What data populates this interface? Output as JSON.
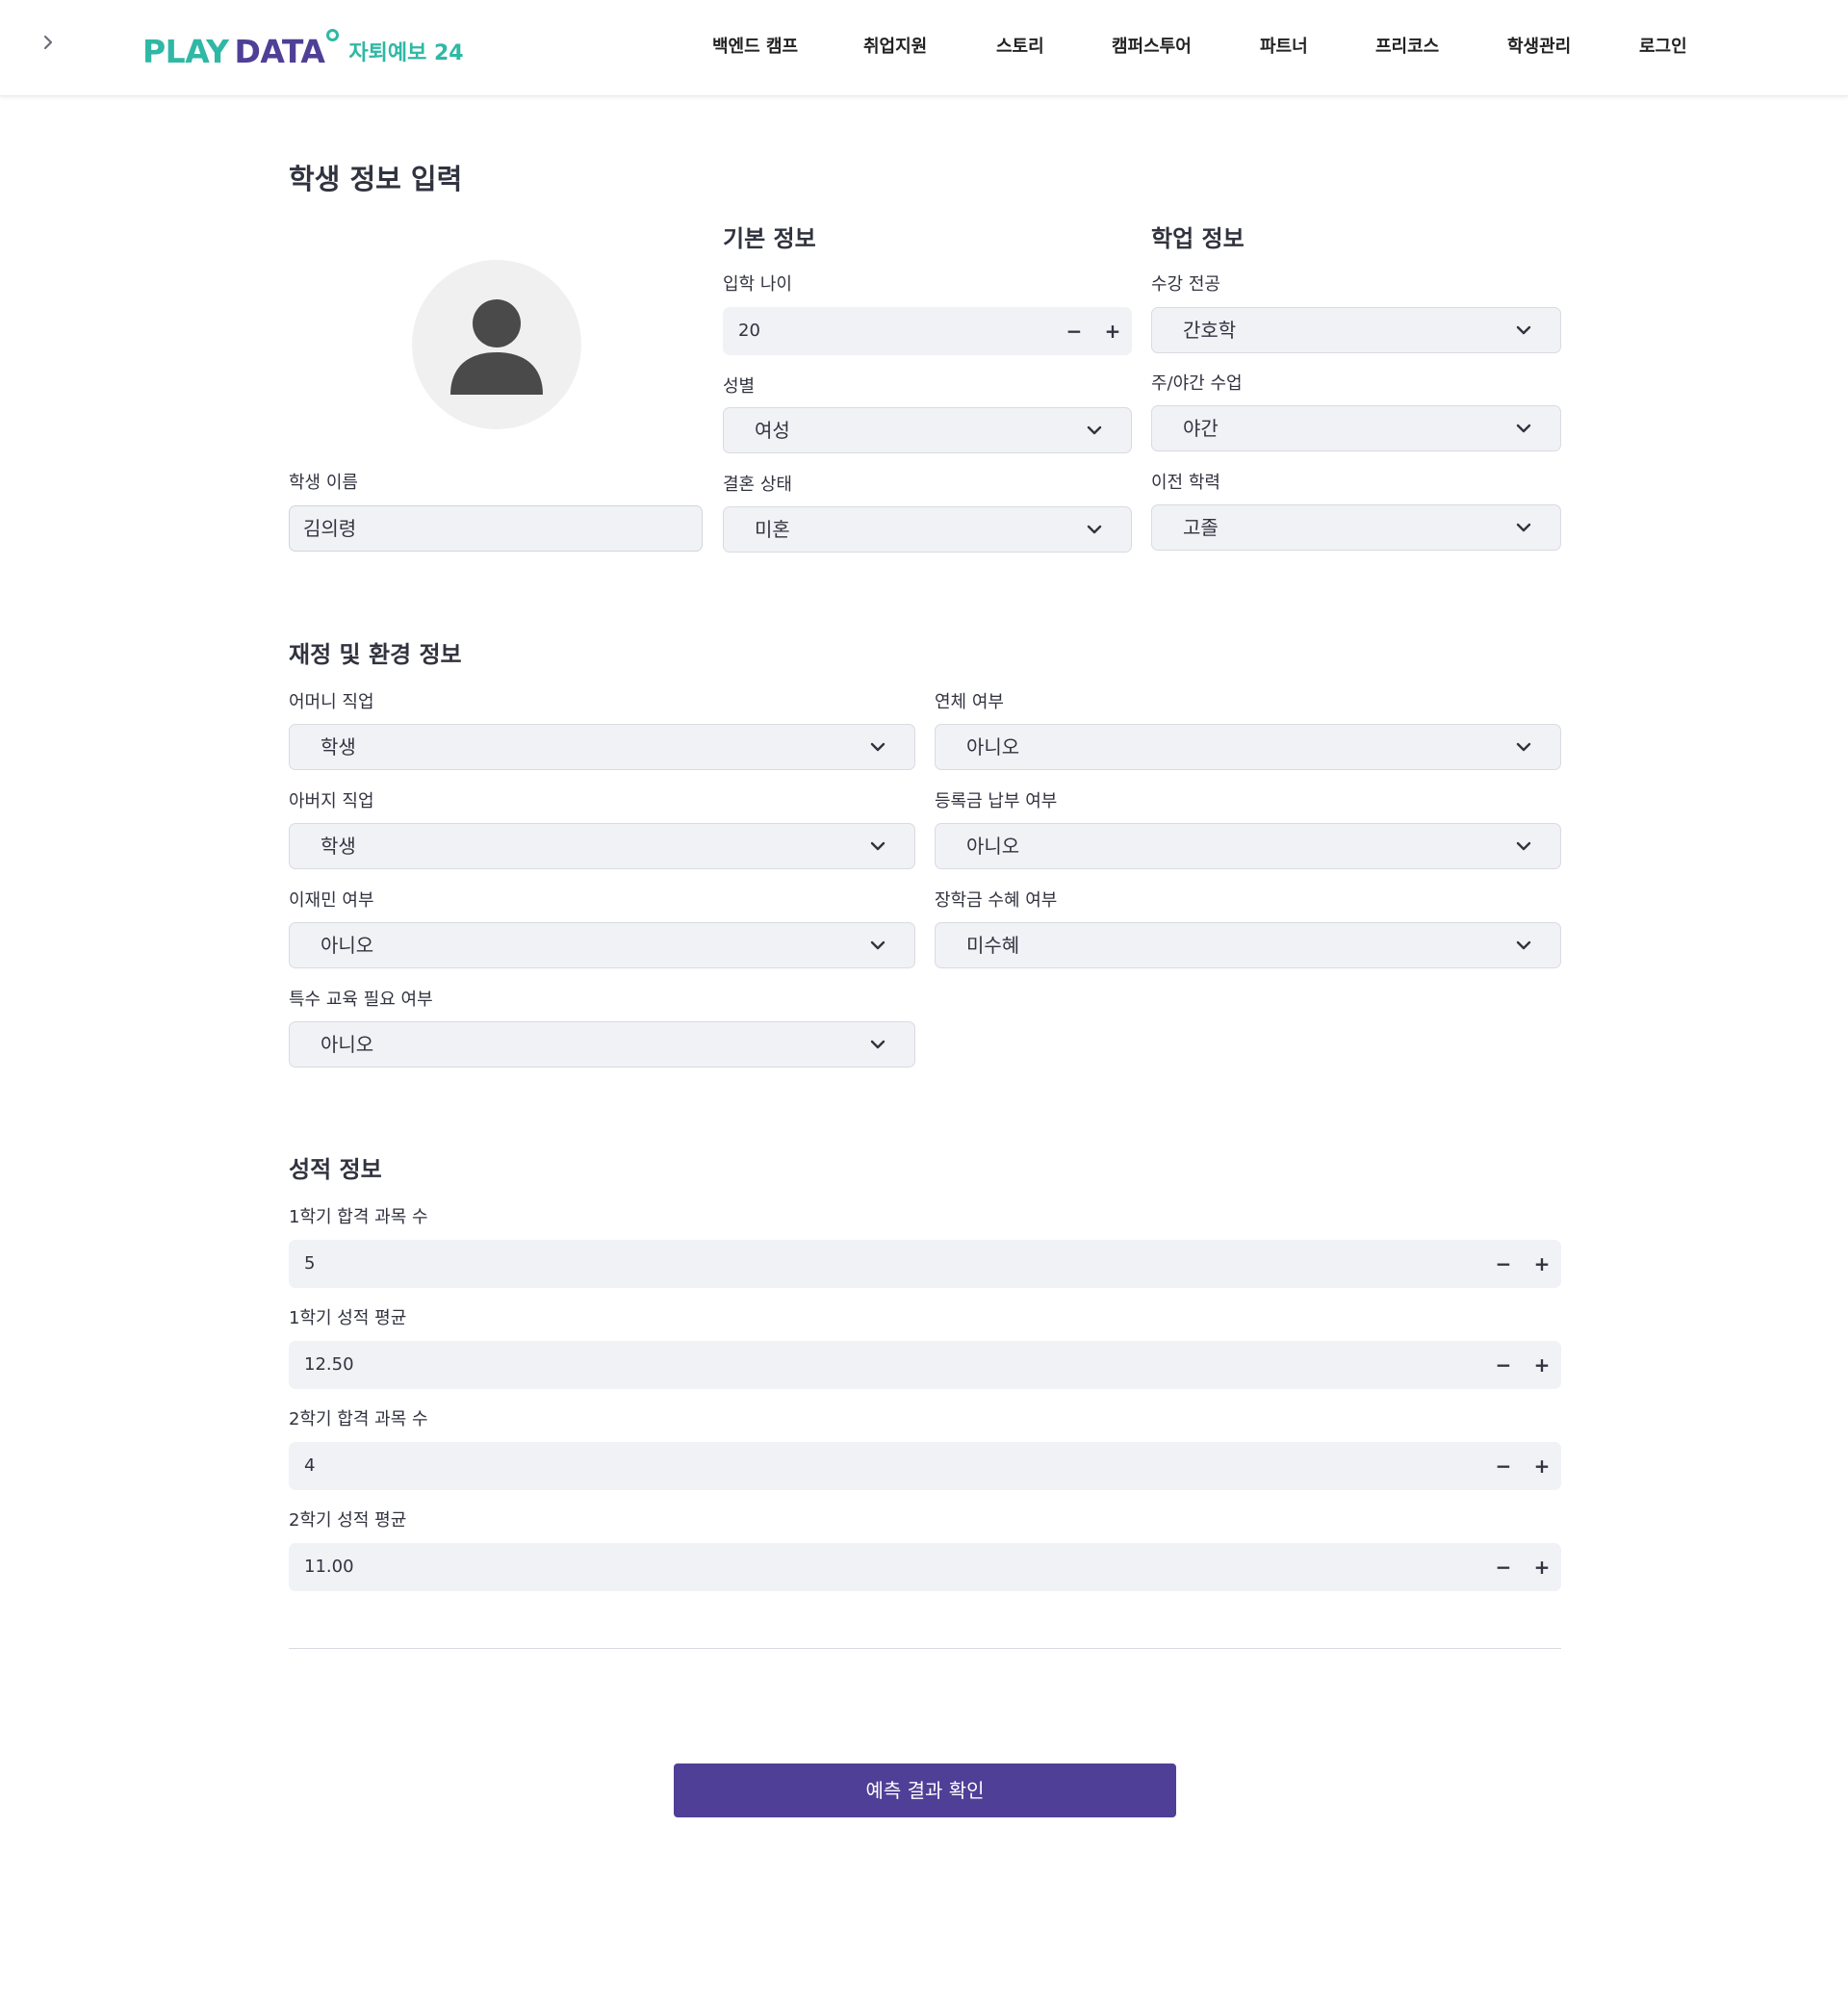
{
  "header": {
    "logo": {
      "play": "PLAY",
      "data": "DATA",
      "sub": "자퇴예보 24"
    },
    "nav": [
      "백엔드 캠프",
      "취업지원",
      "스토리",
      "캠퍼스투어",
      "파트너",
      "프리코스",
      "학생관리",
      "로그인"
    ]
  },
  "page": {
    "title": "학생 정보 입력"
  },
  "basic": {
    "title": "기본 정보",
    "student_name_label": "학생 이름",
    "student_name_value": "김의령",
    "age_label": "입학 나이",
    "age_value": "20",
    "gender_label": "성별",
    "gender_value": "여성",
    "marital_label": "결혼 상태",
    "marital_value": "미혼"
  },
  "academic": {
    "title": "학업 정보",
    "major_label": "수강 전공",
    "major_value": "간호학",
    "daynight_label": "주/야간 수업",
    "daynight_value": "야간",
    "prev_label": "이전 학력",
    "prev_value": "고졸"
  },
  "finance": {
    "title": "재정 및 환경 정보",
    "mother_label": "어머니 직업",
    "mother_value": "학생",
    "father_label": "아버지 직업",
    "father_value": "학생",
    "displaced_label": "이재민 여부",
    "displaced_value": "아니오",
    "special_label": "특수 교육 필요 여부",
    "special_value": "아니오",
    "debtor_label": "연체 여부",
    "debtor_value": "아니오",
    "tuition_label": "등록금 납부 여부",
    "tuition_value": "아니오",
    "scholarship_label": "장학금 수혜 여부",
    "scholarship_value": "미수혜"
  },
  "grades": {
    "title": "성적 정보",
    "s1_pass_label": "1학기 합격 과목 수",
    "s1_pass_value": "5",
    "s1_avg_label": "1학기 성적 평균",
    "s1_avg_value": "12.50",
    "s2_pass_label": "2학기 합격 과목 수",
    "s2_pass_value": "4",
    "s2_avg_label": "2학기 성적 평균",
    "s2_avg_value": "11.00"
  },
  "stepper": {
    "minus": "−",
    "plus": "+"
  },
  "submit_label": "예측 결과 확인",
  "colors": {
    "brand_teal": "#2fb8a5",
    "brand_purple": "#4f3f96",
    "field_bg": "#f0f2f6"
  }
}
